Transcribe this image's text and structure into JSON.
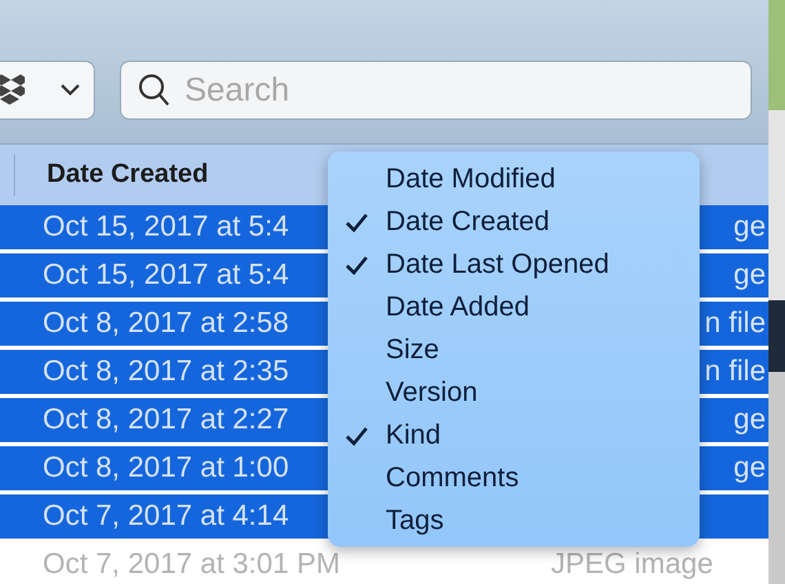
{
  "toolbar": {
    "search": {
      "placeholder": "Search"
    }
  },
  "table": {
    "columns": [
      {
        "label": "Date Created"
      }
    ],
    "rows": [
      {
        "date": "Oct 15, 2017 at 5:4",
        "kind": "ge",
        "selected": true
      },
      {
        "date": "Oct 15, 2017 at 5:4",
        "kind": "ge",
        "selected": true
      },
      {
        "date": "Oct 8, 2017 at 2:58",
        "kind": "n file",
        "selected": true
      },
      {
        "date": "Oct 8, 2017 at 2:35",
        "kind": "n file",
        "selected": true
      },
      {
        "date": "Oct 8, 2017 at 2:27",
        "kind": "ge",
        "selected": true
      },
      {
        "date": "Oct 8, 2017 at 1:00",
        "kind": "ge",
        "selected": true
      },
      {
        "date": "Oct 7, 2017 at 4:14",
        "selected": true
      },
      {
        "date": "Oct 7, 2017 at 3:01 PM",
        "kind": "JPEG image",
        "selected": false
      }
    ]
  },
  "column_menu": {
    "items": [
      {
        "label": "Date Modified",
        "checked": false
      },
      {
        "label": "Date Created",
        "checked": true
      },
      {
        "label": "Date Last Opened",
        "checked": true
      },
      {
        "label": "Date Added",
        "checked": false
      },
      {
        "label": "Size",
        "checked": false
      },
      {
        "label": "Version",
        "checked": false
      },
      {
        "label": "Kind",
        "checked": true
      },
      {
        "label": "Comments",
        "checked": false
      },
      {
        "label": "Tags",
        "checked": false
      }
    ]
  }
}
